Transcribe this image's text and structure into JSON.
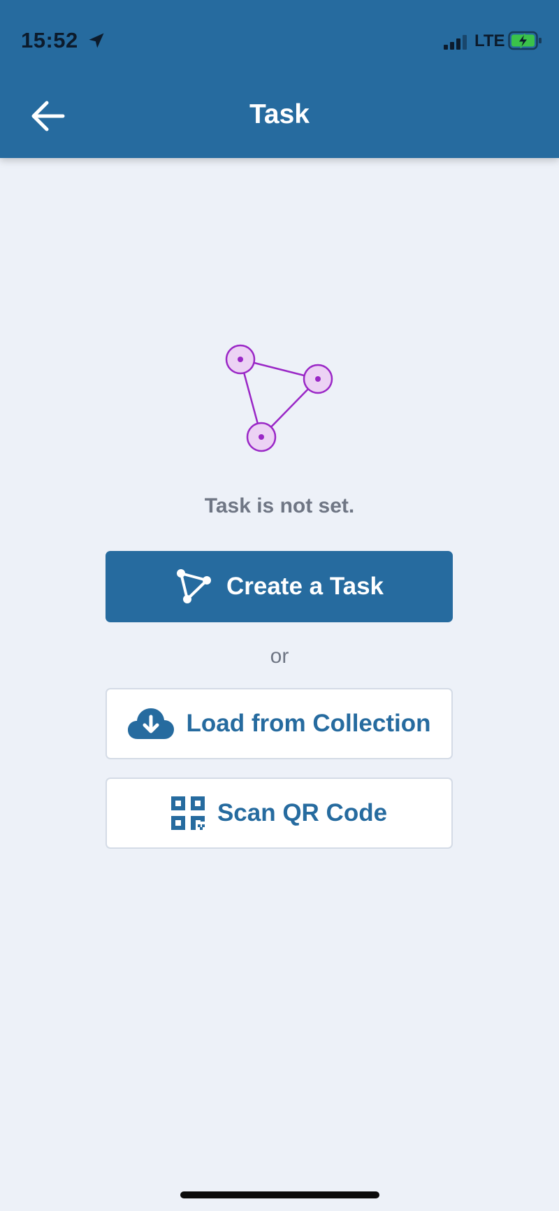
{
  "status_bar": {
    "time": "15:52",
    "network": "LTE"
  },
  "header": {
    "title": "Task",
    "back_icon": "arrow-left-icon"
  },
  "main": {
    "message": "Task is not set.",
    "create_button": {
      "label": "Create a Task",
      "icon": "triangle-nodes-icon"
    },
    "or_label": "or",
    "load_button": {
      "label": "Load from Collection",
      "icon": "cloud-download-icon"
    },
    "scan_button": {
      "label": "Scan QR Code",
      "icon": "qr-code-icon"
    }
  },
  "colors": {
    "header_bg": "#266b9f",
    "primary": "#266b9f",
    "page_bg": "#edf1f8",
    "illustration": "#9a27c6",
    "battery_charge": "#3ac24a"
  }
}
